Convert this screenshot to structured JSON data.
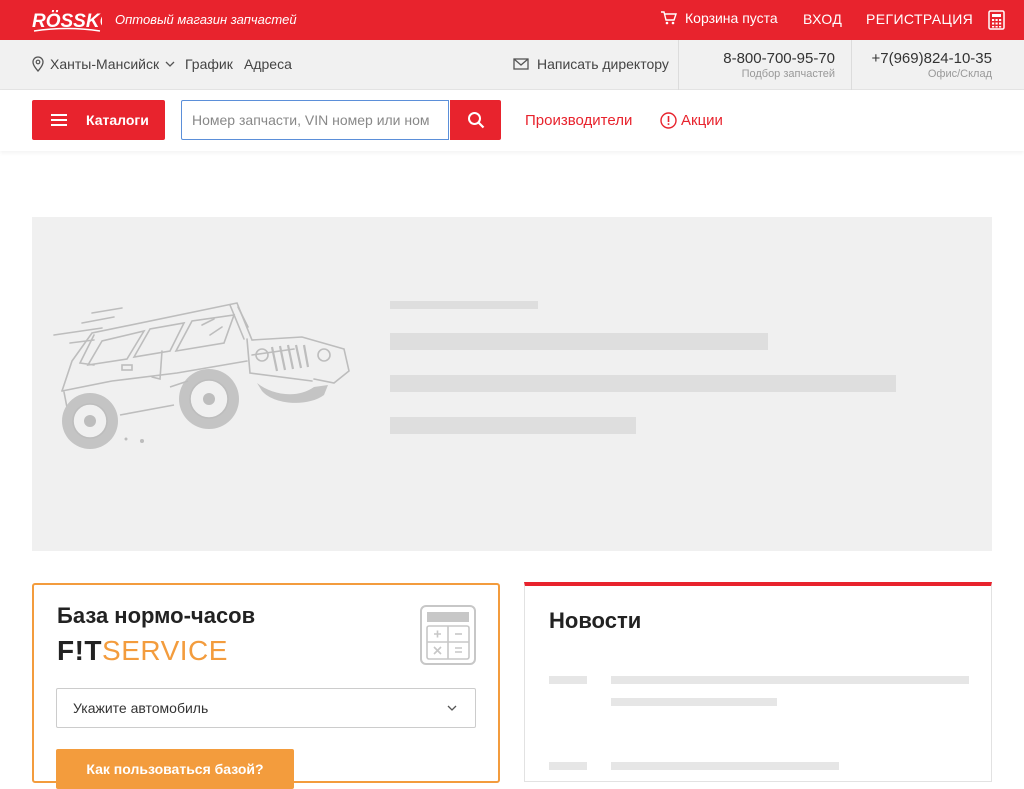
{
  "header": {
    "logo_text": "RÖSSKO",
    "tagline": "Оптовый магазин запчастей",
    "cart_label": "Корзина пуста",
    "login_label": "ВХОД",
    "register_label": "РЕГИСТРАЦИЯ"
  },
  "subbar": {
    "city": "Ханты-Мансийск",
    "schedule": "График",
    "addresses": "Адреса",
    "write_director": "Написать директору",
    "phone1": {
      "number": "8-800-700-95-70",
      "caption": "Подбор запчастей"
    },
    "phone2": {
      "number": "+7(969)824-10-35",
      "caption": "Офис/Склад"
    }
  },
  "navbar": {
    "catalogs_label": "Каталоги",
    "search_placeholder": "Номер запчасти, VIN номер или ном",
    "manufacturers_label": "Производители",
    "promotions_label": "Акции"
  },
  "norm_hours": {
    "title": "База нормо-часов",
    "brand_fit": "F!T",
    "brand_service": "SERVICE",
    "select_placeholder": "Укажите автомобиль",
    "button_label": "Как пользоваться базой?"
  },
  "news": {
    "title": "Новости"
  },
  "colors": {
    "brand_red": "#e8232d",
    "accent_orange": "#f39c3d",
    "placeholder_gray": "#f0f0f0"
  }
}
